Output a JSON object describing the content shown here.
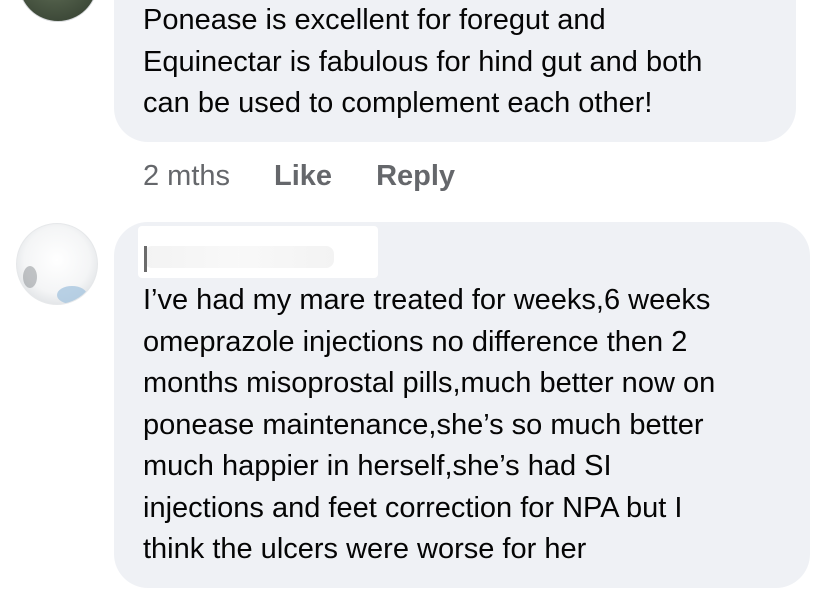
{
  "comments": [
    {
      "text_lines": [
        "Ponease is excellent for foregut and",
        "Equinectar is fabulous for hind gut and both",
        "can be used to complement each other!"
      ],
      "time": "2 mths",
      "like_label": "Like",
      "reply_label": "Reply"
    },
    {
      "author": "",
      "text_lines": [
        "I’ve had my mare treated for weeks,6 weeks",
        "omeprazole injections no difference then 2",
        "months misoprostal pills,much better now on",
        "ponease maintenance,she’s so much better",
        "much happier in herself,she’s had SI",
        "injections and feet correction for NPA but I",
        "think the ulcers were worse for her"
      ]
    }
  ],
  "colors": {
    "bubble": "#eff1f5",
    "text": "#050505",
    "meta": "#65676b"
  }
}
